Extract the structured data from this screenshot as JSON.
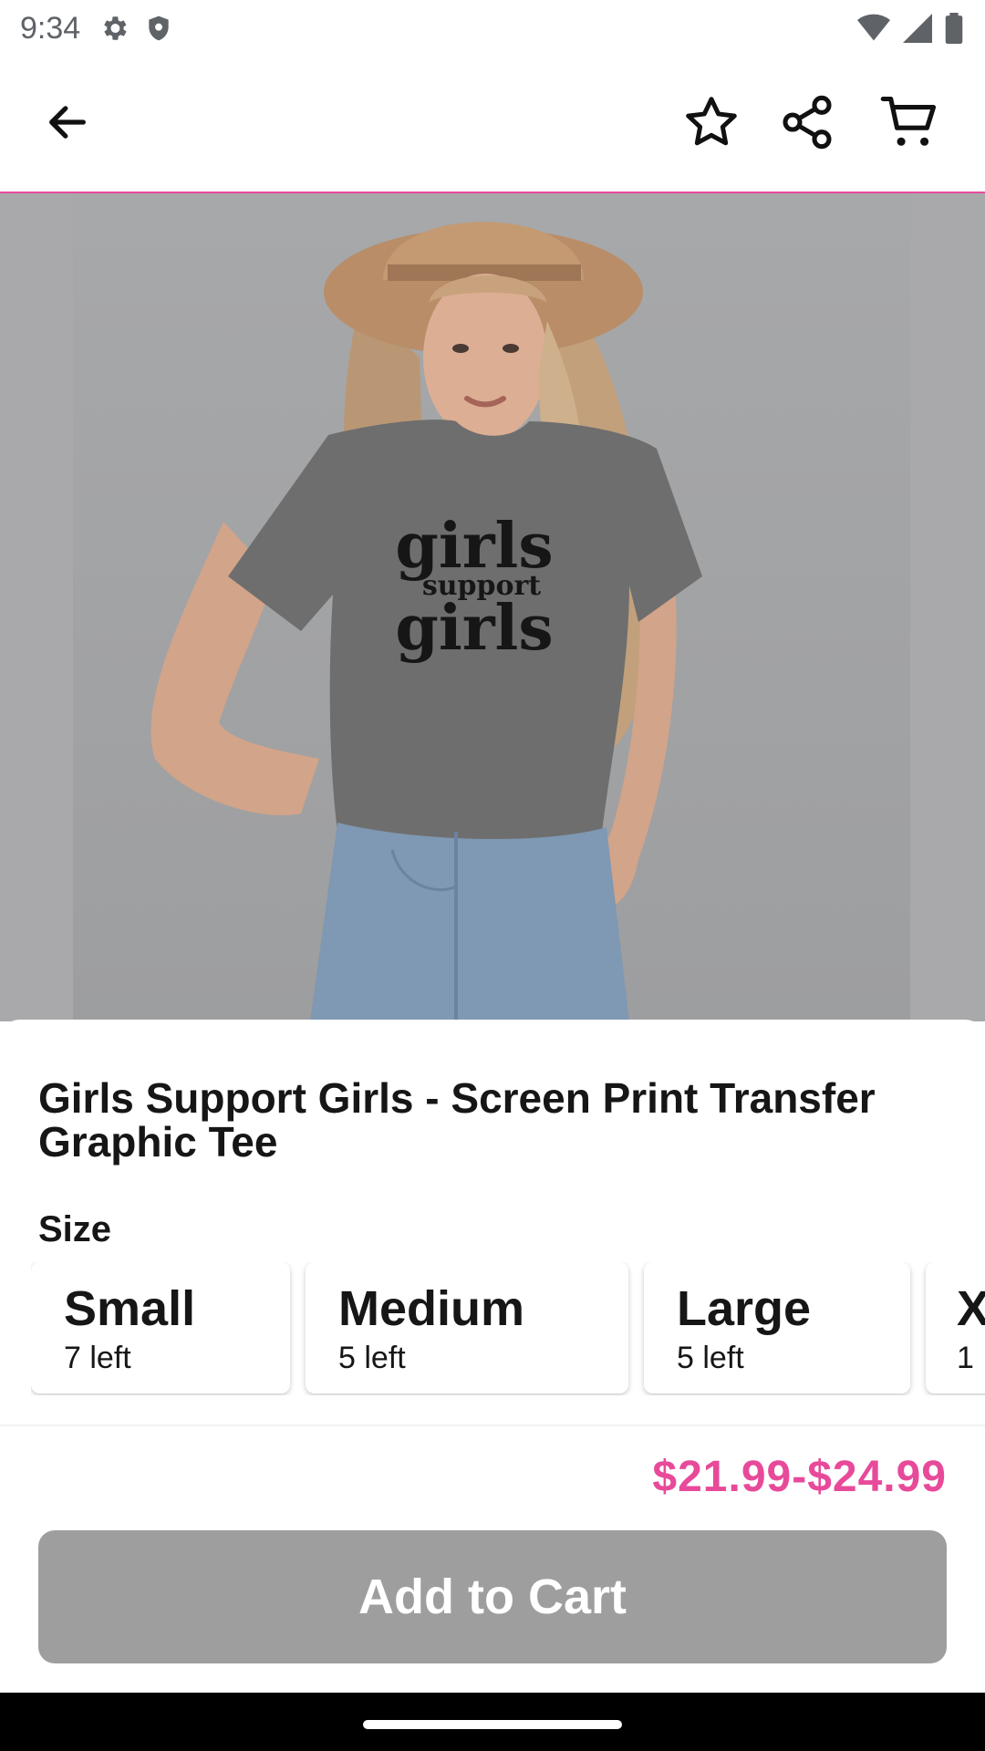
{
  "status_bar": {
    "time": "9:34",
    "left_icons": [
      "settings-icon",
      "shield-icon"
    ],
    "right_icons": [
      "wifi-icon",
      "signal-icon",
      "battery-icon"
    ]
  },
  "app_bar": {
    "icons": [
      "back-arrow-icon",
      "star-icon",
      "share-icon",
      "cart-icon"
    ],
    "accent_color": "#e84a9a"
  },
  "hero": {
    "shirt_text": [
      "girls",
      "support",
      "girls"
    ]
  },
  "product": {
    "title": "Girls Support Girls - Screen Print Transfer Graphic Tee",
    "size_label": "Size",
    "sizes": [
      {
        "name": "Small",
        "stock": "7 left"
      },
      {
        "name": "Medium",
        "stock": "5 left"
      },
      {
        "name": "Large",
        "stock": "5 left"
      },
      {
        "name": "X",
        "stock": "1"
      }
    ]
  },
  "footer": {
    "price": "$21.99-$24.99",
    "price_color": "#e84a9a",
    "add_to_cart_label": "Add to Cart"
  }
}
